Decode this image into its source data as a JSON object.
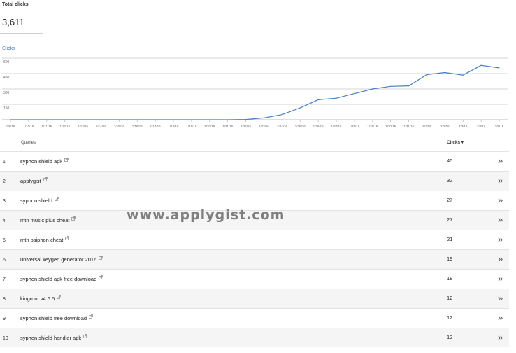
{
  "summary": {
    "label": "Total clicks",
    "value": "3,611"
  },
  "chart_data": {
    "type": "line",
    "title": "Clicks",
    "x": [
      "1/9/16",
      "1/10/16",
      "1/11/16",
      "1/12/16",
      "1/13/16",
      "1/14/16",
      "1/15/16",
      "1/16/16",
      "1/17/16",
      "1/18/16",
      "1/19/16",
      "1/20/16",
      "1/21/16",
      "1/22/16",
      "1/23/16",
      "1/24/16",
      "1/25/16",
      "1/26/16",
      "1/27/16",
      "1/28/16",
      "1/29/16",
      "1/30/16",
      "1/31/16",
      "2/1/16",
      "2/2/16",
      "2/3/16",
      "2/4/16",
      "2/5/16"
    ],
    "values": [
      0,
      0,
      0,
      0,
      0,
      0,
      0,
      0,
      0,
      0,
      0,
      0,
      0,
      3,
      18,
      50,
      115,
      195,
      210,
      255,
      300,
      325,
      330,
      440,
      460,
      435,
      530,
      505
    ],
    "yticks": [
      "600",
      "450",
      "300",
      "150"
    ],
    "ylim": [
      0,
      600
    ],
    "grid": true,
    "color": "#4a7fc2"
  },
  "table": {
    "headers": {
      "queries": "Queries",
      "clicks": "Clicks"
    },
    "sort_icon": "▼",
    "more_icon": "»",
    "rows": [
      {
        "num": "1",
        "query": "syphon shield apk",
        "clicks": "45"
      },
      {
        "num": "2",
        "query": "applygist",
        "clicks": "32"
      },
      {
        "num": "3",
        "query": "syphon shield",
        "clicks": "27"
      },
      {
        "num": "4",
        "query": "mtn music plus cheat",
        "clicks": "27"
      },
      {
        "num": "5",
        "query": "mtn psiphon cheat",
        "clicks": "21"
      },
      {
        "num": "6",
        "query": "universal keygen generator 2016",
        "clicks": "19"
      },
      {
        "num": "7",
        "query": "syphon shield apk free download",
        "clicks": "18"
      },
      {
        "num": "8",
        "query": "kingroot v4.6.5",
        "clicks": "12"
      },
      {
        "num": "9",
        "query": "syphon shield free download",
        "clicks": "12"
      },
      {
        "num": "10",
        "query": "syphon shield handler apk",
        "clicks": "12"
      }
    ]
  },
  "watermark": "www.applygist.com"
}
